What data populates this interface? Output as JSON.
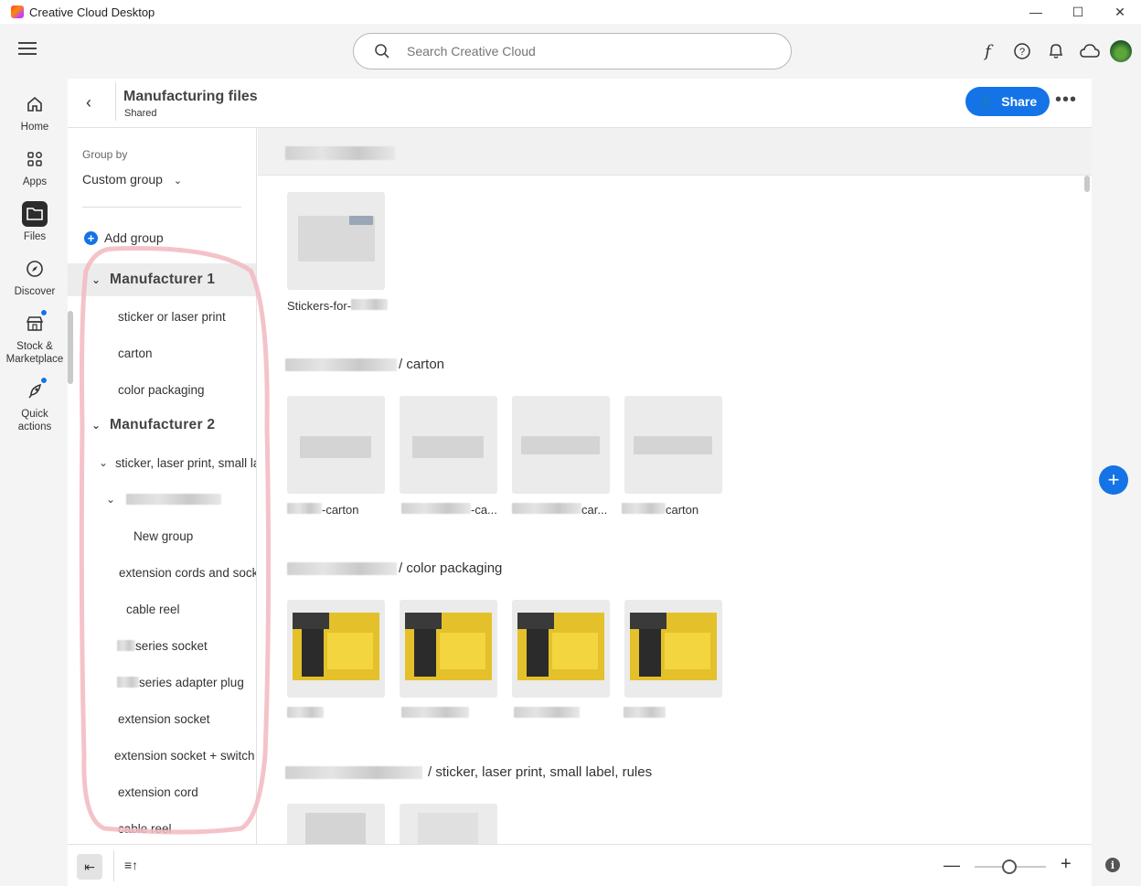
{
  "window": {
    "title": "Creative Cloud Desktop"
  },
  "search": {
    "placeholder": "Search Creative Cloud"
  },
  "nav": {
    "home": "Home",
    "apps": "Apps",
    "files": "Files",
    "discover": "Discover",
    "stock_line1": "Stock &",
    "stock_line2": "Marketplace",
    "quick_line1": "Quick",
    "quick_line2": "actions"
  },
  "header": {
    "title": "Manufacturing files",
    "subtitle": "Shared",
    "share": "Share"
  },
  "groups": {
    "group_by_label": "Group by",
    "group_by_value": "Custom group",
    "add_group": "Add group",
    "tree": [
      "Manufacturer 1",
      "sticker or laser print",
      "carton",
      "color packaging",
      "Manufacturer 2",
      "sticker, laser print, small lal",
      "New group",
      "extension cords and sock",
      "cable reel",
      "series socket",
      "series adapter plug",
      "extension socket",
      "extension socket + switch",
      "extension cord",
      "cable reel"
    ]
  },
  "content": {
    "sections": [
      {
        "title": ""
      },
      {
        "title": "/ carton"
      },
      {
        "title": "/ color packaging"
      },
      {
        "title": "/ sticker, laser print, small label, rules"
      }
    ],
    "file_labels": [
      "Stickers-for-",
      "-carton",
      "-ca...",
      "car...",
      "carton"
    ]
  },
  "colors": {
    "accent": "#1473e6",
    "highlight_ring": "#f2b8c0",
    "thumb_yellow": "#e4c12a"
  }
}
